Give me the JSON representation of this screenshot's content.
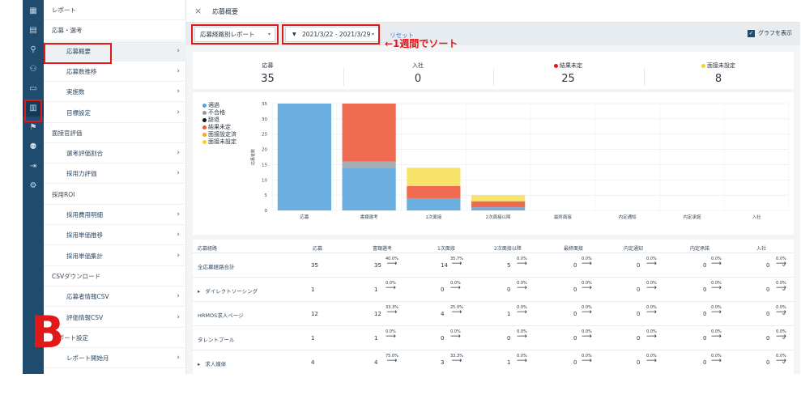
{
  "sidebar": {
    "items": [
      {
        "label": "レポート",
        "kind": "sec",
        "chev": ""
      },
      {
        "label": "応募・選考",
        "kind": "sec",
        "chev": ""
      },
      {
        "label": "応募概要",
        "kind": "sub",
        "chev": "›"
      },
      {
        "label": "応募数推移",
        "kind": "sub",
        "chev": "›"
      },
      {
        "label": "実施数",
        "kind": "sub",
        "chev": "›"
      },
      {
        "label": "目標設定",
        "kind": "sub",
        "chev": "›"
      },
      {
        "label": "面接官評価",
        "kind": "sec",
        "chev": ""
      },
      {
        "label": "選考評価割合",
        "kind": "sub",
        "chev": "›"
      },
      {
        "label": "採用力評価",
        "kind": "sub",
        "chev": "›"
      },
      {
        "label": "採用ROI",
        "kind": "sec",
        "chev": ""
      },
      {
        "label": "採用費用明細",
        "kind": "sub",
        "chev": "›"
      },
      {
        "label": "採用単価推移",
        "kind": "sub",
        "chev": "›"
      },
      {
        "label": "採用単価集計",
        "kind": "sub",
        "chev": "›"
      },
      {
        "label": "CSVダウンロード",
        "kind": "sec",
        "chev": ""
      },
      {
        "label": "応募者情報CSV",
        "kind": "sub",
        "chev": "›"
      },
      {
        "label": "評価情報CSV",
        "kind": "sub",
        "chev": "›"
      },
      {
        "label": "レポート設定",
        "kind": "sec",
        "chev": ""
      },
      {
        "label": "レポート開始月",
        "kind": "sub",
        "chev": "›"
      }
    ]
  },
  "rail": {
    "icons": [
      "dashboard-icon",
      "document-icon",
      "search-icon",
      "user-add-icon",
      "briefcase-icon",
      "bar-chart-icon",
      "megaphone-icon",
      "team-icon",
      "export-icon",
      "gear-icon"
    ],
    "glyphs": [
      "▦",
      "▤",
      "⚲",
      "⚇",
      "▭",
      "▥",
      "⚑",
      "⚉",
      "⇥",
      "⚙"
    ]
  },
  "header": {
    "close": "×",
    "title": "応募概要"
  },
  "filters": {
    "report_type": "応募経路別レポート",
    "date_range": "2021/3/22 - 2021/3/29",
    "filter_icon": "▼",
    "reset": "リセット",
    "show_graph": "グラフを表示",
    "caret": "▾",
    "check": "✓"
  },
  "annotation": "←1週間でソート",
  "overlay_letter": "B",
  "summary": [
    {
      "label": "応募",
      "value": "35",
      "dot": ""
    },
    {
      "label": "入社",
      "value": "0",
      "dot": ""
    },
    {
      "label": "結果未定",
      "value": "25",
      "dot": "#e0191a"
    },
    {
      "label": "面接未設定",
      "value": "8",
      "dot": "#f3d22b"
    }
  ],
  "legend": [
    {
      "label": "適過",
      "color": "#5a9fd4"
    },
    {
      "label": "不合格",
      "color": "#8f9aa3"
    },
    {
      "label": "辞退",
      "color": "#111111"
    },
    {
      "label": "結果未定",
      "color": "#e8563c"
    },
    {
      "label": "面接設定済",
      "color": "#f5a623"
    },
    {
      "label": "面接未設定",
      "color": "#f3d22b"
    }
  ],
  "chart_data": {
    "type": "bar",
    "stacked": true,
    "ylabel": "応募者数",
    "ylim": [
      0,
      35
    ],
    "yticks": [
      0,
      5,
      10,
      15,
      20,
      25,
      30,
      35
    ],
    "categories": [
      "応募",
      "書類選考",
      "1次面接",
      "2次面接以降",
      "最終面接",
      "内定通知",
      "内定承諾",
      "入社"
    ],
    "series": [
      {
        "name": "適過",
        "color": "#6aaee0",
        "values": [
          35,
          14,
          4,
          1,
          0,
          0,
          0,
          0
        ]
      },
      {
        "name": "不合格",
        "color": "#a3adb5",
        "values": [
          0,
          2,
          0,
          0,
          0,
          0,
          0,
          0
        ]
      },
      {
        "name": "辞退",
        "color": "#222222",
        "values": [
          0,
          0,
          0,
          0,
          0,
          0,
          0,
          0
        ]
      },
      {
        "name": "結果未定",
        "color": "#ee6b52",
        "values": [
          0,
          19,
          4,
          2,
          0,
          0,
          0,
          0
        ]
      },
      {
        "name": "面接設定済",
        "color": "#f5a623",
        "values": [
          0,
          0,
          0,
          0,
          0,
          0,
          0,
          0
        ]
      },
      {
        "name": "面接未設定",
        "color": "#f7e36b",
        "values": [
          0,
          0,
          6,
          2,
          0,
          0,
          0,
          0
        ]
      }
    ],
    "legend_position": "left"
  },
  "table": {
    "headers": [
      "応募経路",
      "応募",
      "書類選考",
      "1次面接",
      "2次面接以降",
      "最終面接",
      "内定通知",
      "内定承諾",
      "入社"
    ],
    "arrow": "⟶",
    "expand": "⌄",
    "rows": [
      {
        "name": "全応募経路合計",
        "prefix": "",
        "values": [
          "35",
          "35",
          "14",
          "5",
          "0",
          "0",
          "0",
          "0"
        ],
        "pcts": [
          "40.0%",
          "35.7%",
          "0.0%",
          "0.0%",
          "0.0%",
          "0.0%",
          "0.0%"
        ]
      },
      {
        "name": "ダイレクトソーシング",
        "prefix": "▸",
        "values": [
          "1",
          "1",
          "0",
          "0",
          "0",
          "0",
          "0",
          "0"
        ],
        "pcts": [
          "0.0%",
          "0.0%",
          "0.0%",
          "0.0%",
          "0.0%",
          "0.0%",
          "0.0%"
        ]
      },
      {
        "name": "HRMOS求人ページ",
        "prefix": "",
        "values": [
          "12",
          "12",
          "4",
          "1",
          "0",
          "0",
          "0",
          "0"
        ],
        "pcts": [
          "33.3%",
          "25.0%",
          "0.0%",
          "0.0%",
          "0.0%",
          "0.0%",
          "0.0%"
        ]
      },
      {
        "name": "タレントプール",
        "prefix": "",
        "values": [
          "1",
          "1",
          "0",
          "0",
          "0",
          "0",
          "0",
          "0"
        ],
        "pcts": [
          "0.0%",
          "0.0%",
          "0.0%",
          "0.0%",
          "0.0%",
          "0.0%",
          "0.0%"
        ]
      },
      {
        "name": "求人媒体",
        "prefix": "▸",
        "values": [
          "4",
          "4",
          "3",
          "1",
          "0",
          "0",
          "0",
          "0"
        ],
        "pcts": [
          "75.0%",
          "33.3%",
          "0.0%",
          "0.0%",
          "0.0%",
          "0.0%",
          "0.0%"
        ]
      }
    ]
  }
}
